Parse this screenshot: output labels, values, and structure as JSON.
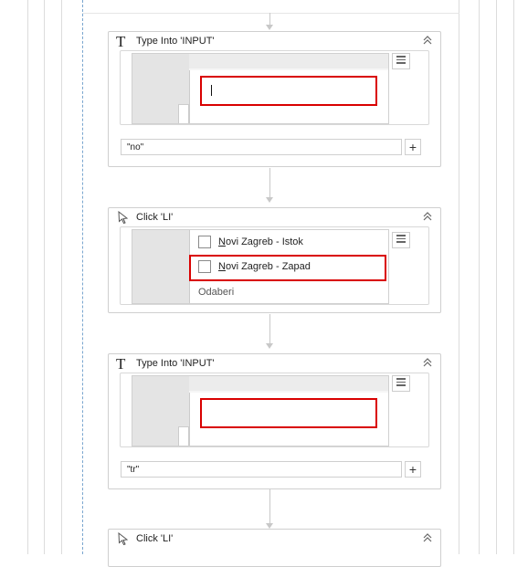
{
  "activities": [
    {
      "type_icon": "T",
      "title": "Type Into 'INPUT'",
      "input_value": "\"no\"",
      "plus_label": "+"
    },
    {
      "type_icon": "cursor",
      "title": "Click 'LI'",
      "options": [
        {
          "underlined": "N",
          "label": "ovi Zagreb - Istok"
        },
        {
          "underlined": "N",
          "label": "ovi Zagreb - Zapad"
        }
      ],
      "footer_text": "Odaberi"
    },
    {
      "type_icon": "T",
      "title": "Type Into 'INPUT'",
      "input_value": "\"tr\"",
      "plus_label": "+"
    },
    {
      "type_icon": "cursor",
      "title": "Click 'LI'"
    }
  ],
  "colors": {
    "highlight": "#d90000",
    "sequence_border": "#7aa6cf",
    "card_border": "#cfcfcf"
  },
  "icons": {
    "collapse": "double-chevron-up-icon",
    "menu": "hamburger-menu-icon",
    "type": "type-into-icon",
    "click": "click-cursor-icon"
  }
}
